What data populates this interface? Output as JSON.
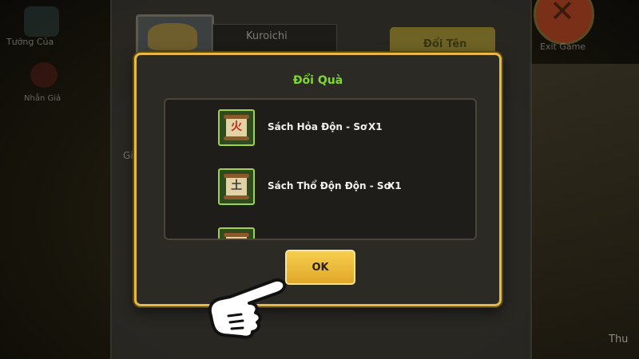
{
  "background": {
    "top_left_label": "Tướng Của",
    "sub_label": "Nhẫn Giả",
    "hero_name": "Kuroichi",
    "rename_button": "Đổi Tên",
    "gift_label": "Gi",
    "exit_label": "Exit Game",
    "corner_label": "Thu"
  },
  "dialog": {
    "title": "Đổi Quà",
    "rewards": [
      {
        "name": "Sách Hỏa Độn - Sơ",
        "qty": "X1",
        "glyph": "火"
      },
      {
        "name": "Sách Thổ Độn Độn - Sơ",
        "qty": "X1",
        "glyph": "土"
      },
      {
        "name": "",
        "qty": "",
        "glyph": ""
      }
    ],
    "ok_label": "OK"
  },
  "colors": {
    "title_green": "#7fd82c",
    "dialog_border": "#e6b844",
    "ok_button": "#f0bd3c",
    "item_border": "#9ed24a"
  }
}
